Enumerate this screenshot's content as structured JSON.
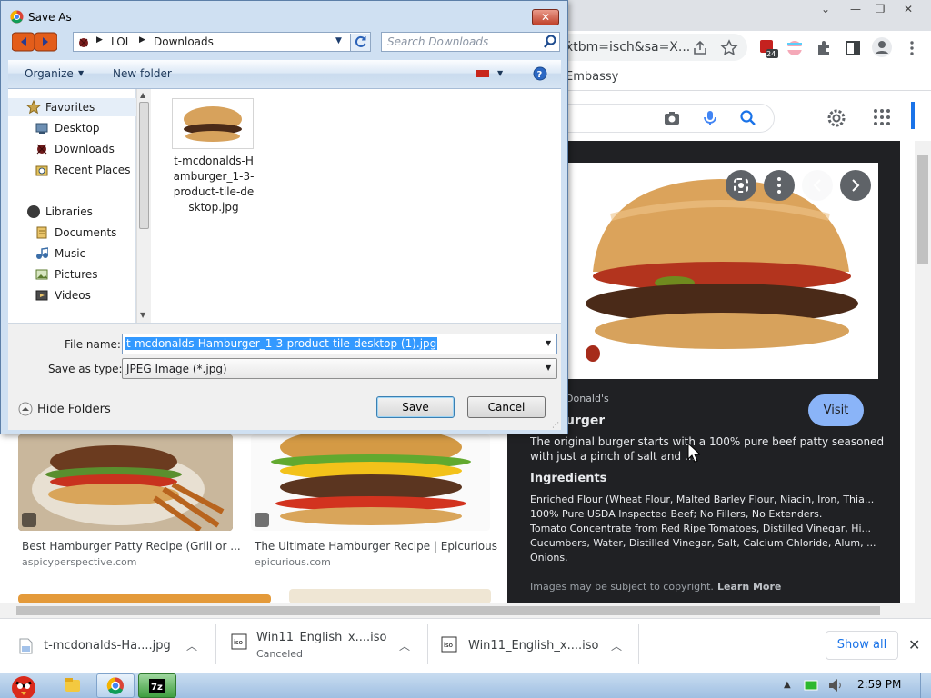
{
  "browser": {
    "omnibox_url": "ẋtbm=isch&sa=X...",
    "bookmark_item": "Embassy",
    "extension_badge": "24",
    "results": [
      {
        "title": "Best Hamburger Patty Recipe (Grill or ...",
        "source": "aspicyperspective.com"
      },
      {
        "title": "The Ultimate Hamburger Recipe | Epicurious",
        "source": "epicurious.com"
      }
    ],
    "preview": {
      "site": "Donald's",
      "heading": "urger",
      "desc_line1": "The original burger starts with a 100% pure beef patty seasoned",
      "desc_line2": "with just a pinch of salt and ...",
      "ingredients_heading": "Ingredients",
      "ingredients": [
        "Enriched Flour (Wheat Flour, Malted Barley Flour, Niacin, Iron, Thia...",
        "100% Pure USDA Inspected Beef; No Fillers, No Extenders.",
        "Tomato Concentrate from Red Ripe Tomatoes, Distilled Vinegar, Hi...",
        "Cucumbers, Water, Distilled Vinegar, Salt, Calcium Chloride, Alum, ...",
        "Onions."
      ],
      "copyright_text": "Images may be subject to copyright.",
      "learn_more": "Learn More",
      "visit_label": "Visit"
    }
  },
  "downloads": {
    "items": [
      {
        "name": "t-mcdonalds-Ha....jpg",
        "status": ""
      },
      {
        "name": "Win11_English_x....iso",
        "status": "Canceled"
      },
      {
        "name": "Win11_English_x....iso",
        "status": ""
      }
    ],
    "show_all": "Show all"
  },
  "dialog": {
    "title": "Save As",
    "breadcrumb": [
      "LOL",
      "Downloads"
    ],
    "search_placeholder": "Search Downloads",
    "organize": "Organize",
    "new_folder": "New folder",
    "nav": {
      "favorites": "Favorites",
      "favorites_items": [
        "Desktop",
        "Downloads",
        "Recent Places"
      ],
      "libraries": "Libraries",
      "libraries_items": [
        "Documents",
        "Music",
        "Pictures",
        "Videos"
      ]
    },
    "file": {
      "name_lines": [
        "t-mcdonalds-H",
        "amburger_1-3-",
        "product-tile-de",
        "sktop.jpg"
      ]
    },
    "file_name_label": "File name:",
    "file_name_value": "t-mcdonalds-Hamburger_1-3-product-tile-desktop (1).jpg",
    "save_type_label": "Save as type:",
    "save_type_value": "JPEG Image (*.jpg)",
    "hide_folders": "Hide Folders",
    "save": "Save",
    "cancel": "Cancel"
  },
  "taskbar": {
    "clock": "2:59 PM"
  },
  "colors": {
    "accent": "#1a73e8",
    "dialog_frame": "#cfe0f2",
    "panel_bg": "#202124",
    "visit": "#8ab4f8"
  }
}
